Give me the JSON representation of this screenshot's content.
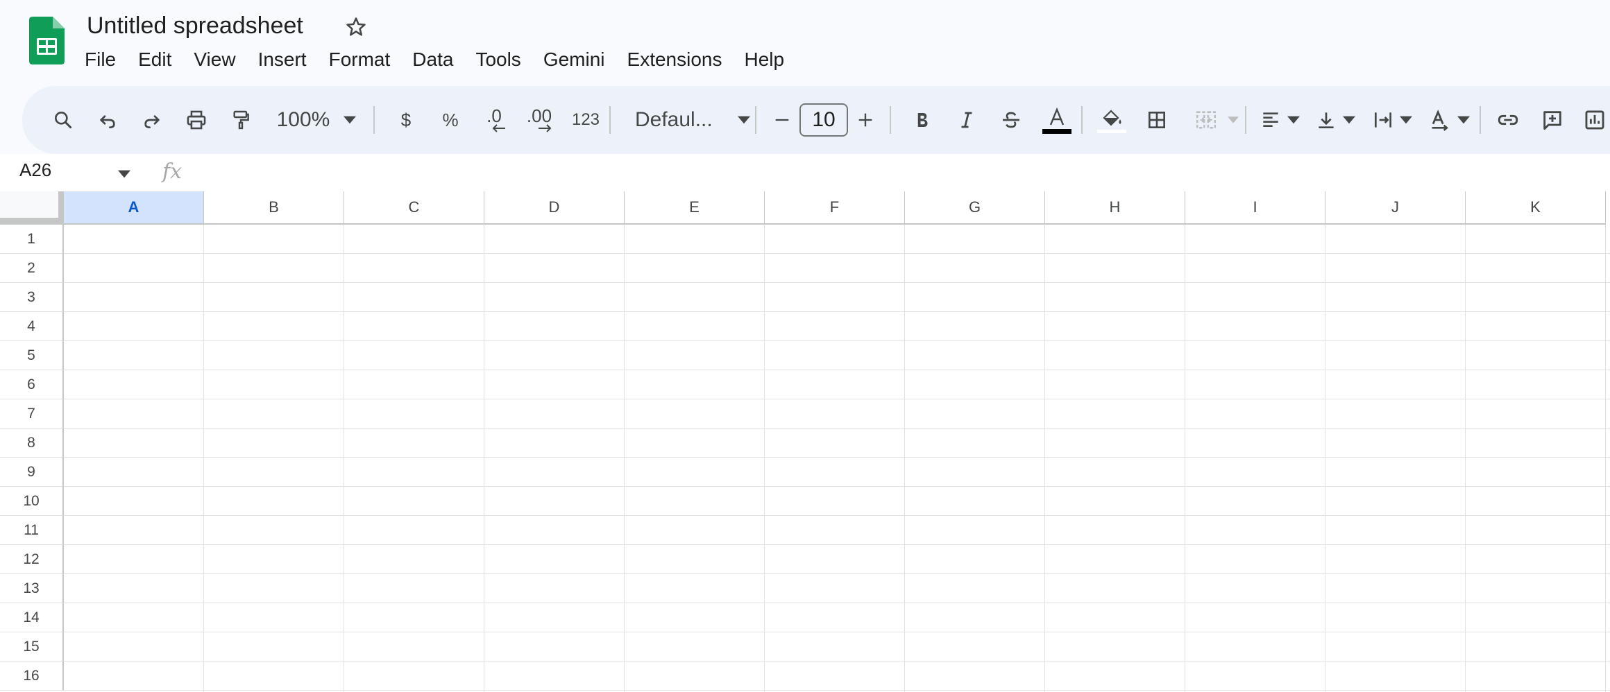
{
  "app": {
    "title": "Untitled spreadsheet",
    "accent_color": "#0f9d58",
    "icons": {
      "logo": "sheets-logo-icon",
      "star": "star-outline-icon"
    }
  },
  "menubar": {
    "items": [
      {
        "label": "File"
      },
      {
        "label": "Edit"
      },
      {
        "label": "View"
      },
      {
        "label": "Insert"
      },
      {
        "label": "Format"
      },
      {
        "label": "Data"
      },
      {
        "label": "Tools"
      },
      {
        "label": "Gemini"
      },
      {
        "label": "Extensions"
      },
      {
        "label": "Help"
      }
    ]
  },
  "toolbar": {
    "zoom": "100%",
    "currency": "$",
    "percent": "%",
    "decrease_decimal": ".0",
    "increase_decimal": ".00",
    "more_formats": "123",
    "font": "Defaul...",
    "font_size": "10",
    "text_color": "#000000"
  },
  "formula_bar": {
    "name_box": "A26",
    "fx_label": "fx",
    "content": ""
  },
  "grid": {
    "selected_column": "A",
    "columns": [
      "A",
      "B",
      "C",
      "D",
      "E",
      "F",
      "G",
      "H",
      "I",
      "J",
      "K"
    ],
    "rows": [
      "1",
      "2",
      "3",
      "4",
      "5",
      "6",
      "7",
      "8",
      "9",
      "10",
      "11",
      "12",
      "13",
      "14",
      "15",
      "16"
    ]
  }
}
